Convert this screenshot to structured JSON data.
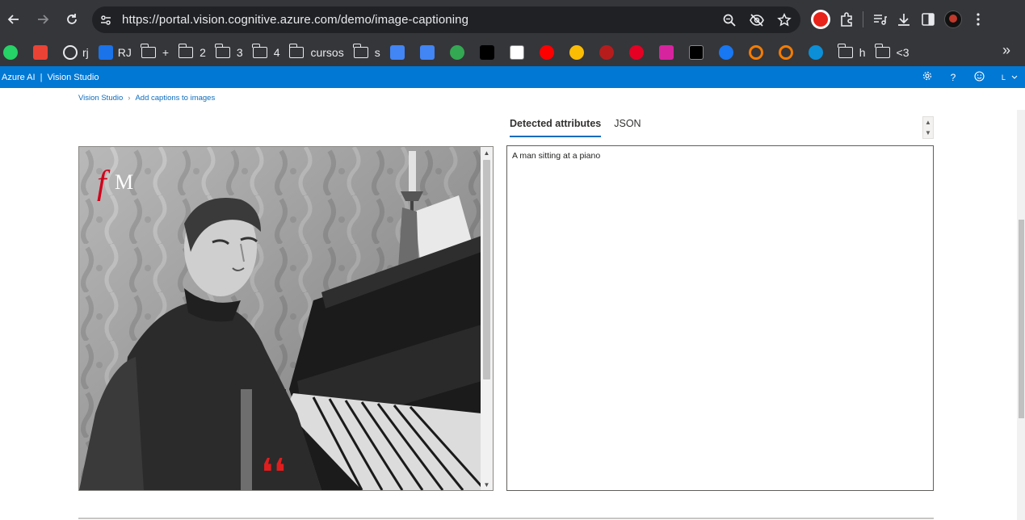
{
  "browser": {
    "url": "https://portal.vision.cognitive.azure.com/demo/image-captioning",
    "nav_icons": [
      "back-icon",
      "forward-icon",
      "reload-icon"
    ],
    "omnibox_icons": [
      "zoom-icon",
      "eye-off-icon",
      "star-icon"
    ],
    "toolbar_icons": [
      "adblock-extension-icon",
      "extensions-puzzle-icon",
      "media-queue-icon",
      "download-icon",
      "side-panel-icon",
      "profile-avatar",
      "kebab-menu-icon"
    ]
  },
  "bookmarks": [
    {
      "label": "",
      "icon": "whatsapp-icon",
      "color": "#25d366"
    },
    {
      "label": "",
      "icon": "gmail-icon",
      "color": "#ea4335"
    },
    {
      "label": "rj",
      "icon": "globe-icon",
      "color": "#e8eaed"
    },
    {
      "label": "RJ",
      "icon": "rj-app-icon",
      "color": "#1a73e8"
    },
    {
      "label": "+",
      "icon": "folder-icon"
    },
    {
      "label": "2",
      "icon": "folder-icon"
    },
    {
      "label": "3",
      "icon": "folder-icon"
    },
    {
      "label": "4",
      "icon": "folder-icon"
    },
    {
      "label": "cursos",
      "icon": "folder-icon"
    },
    {
      "label": "s",
      "icon": "folder-icon"
    },
    {
      "label": "",
      "icon": "calendar-icon",
      "color": "#4285f4"
    },
    {
      "label": "",
      "icon": "translate-icon",
      "color": "#4285f4"
    },
    {
      "label": "",
      "icon": "assistant-icon",
      "color": "#34a853"
    },
    {
      "label": "",
      "icon": "k-app-icon",
      "color": "#000000"
    },
    {
      "label": "",
      "icon": "amazon-icon",
      "color": "#ffffff"
    },
    {
      "label": "",
      "icon": "youtube-icon",
      "color": "#ff0000"
    },
    {
      "label": "",
      "icon": "chrome-like-icon",
      "color": "#fbbc04"
    },
    {
      "label": "",
      "icon": "swirl-icon",
      "color": "#b71c1c"
    },
    {
      "label": "",
      "icon": "pinterest-icon",
      "color": "#e60023"
    },
    {
      "label": "",
      "icon": "instagram-icon",
      "color": "#d6249f"
    },
    {
      "label": "",
      "icon": "x-icon",
      "color": "#000000"
    },
    {
      "label": "",
      "icon": "facebook-icon",
      "color": "#1877f2"
    },
    {
      "label": "",
      "icon": "orange-ring-icon",
      "color": "#f57c00"
    },
    {
      "label": "",
      "icon": "orange-ring-icon-2",
      "color": "#f57c00"
    },
    {
      "label": "",
      "icon": "edge-icon",
      "color": "#0c8fd6"
    },
    {
      "label": "h",
      "icon": "folder-icon"
    },
    {
      "label": "<3",
      "icon": "folder-icon"
    }
  ],
  "azure_header": {
    "brand": "Azure AI",
    "separator": "|",
    "product": "Vision Studio",
    "icons": [
      "settings-icon",
      "help-icon",
      "feedback-smiley-icon",
      "account-icon"
    ],
    "account_initial": "L",
    "bg_color": "#0078d4"
  },
  "breadcrumb": {
    "root": "Vision Studio",
    "chevron": "›",
    "current": "Add captions to images"
  },
  "tabs": [
    {
      "label": "Detected attributes",
      "active": true
    },
    {
      "label": "JSON",
      "active": false
    }
  ],
  "image": {
    "logo_script": "f",
    "logo_letter": "M",
    "quote_glyph": "❛❛"
  },
  "result": {
    "caption": "A man sitting at a piano"
  }
}
